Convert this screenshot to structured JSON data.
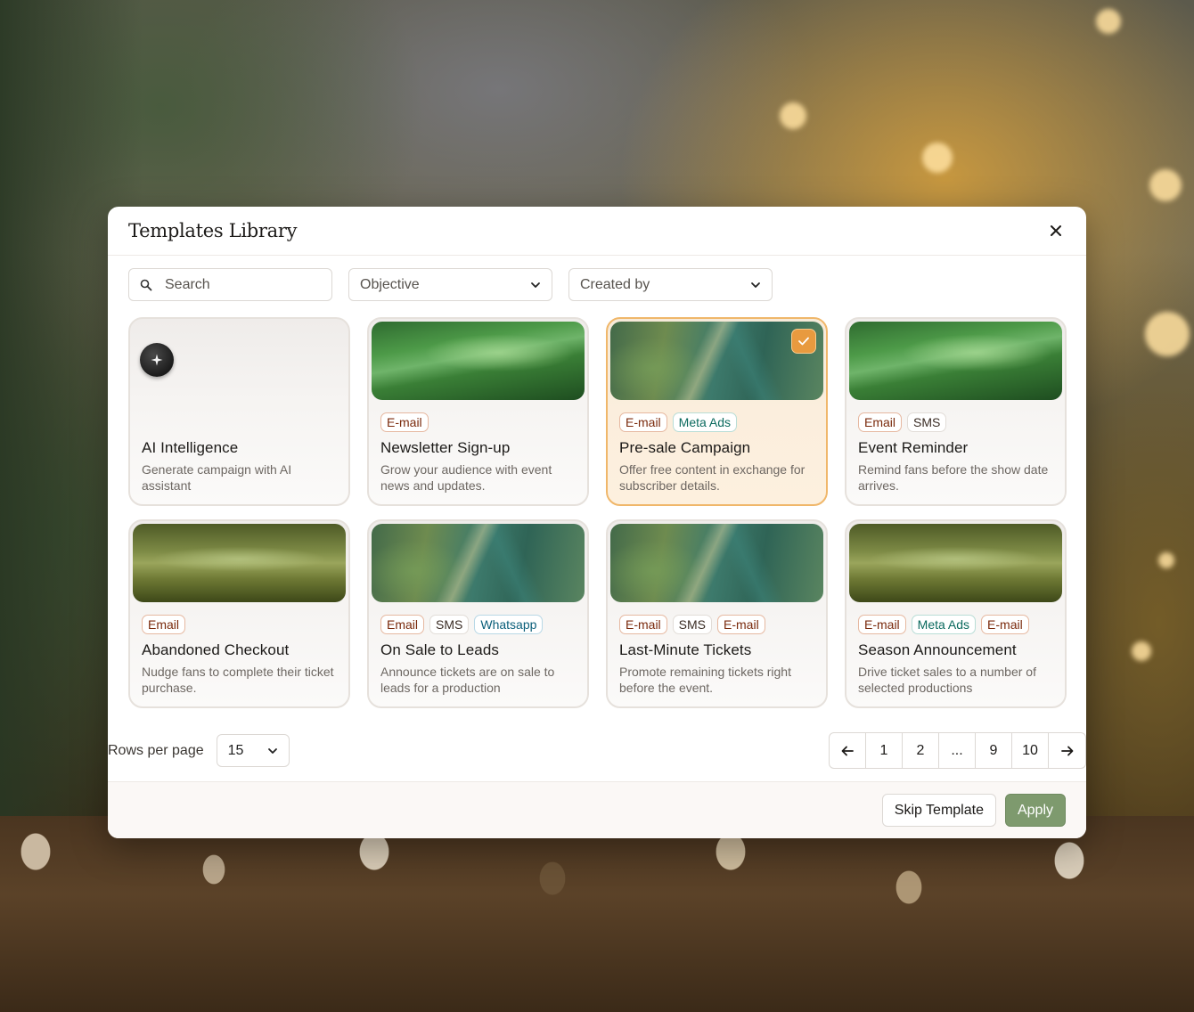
{
  "modal": {
    "title": "Templates Library"
  },
  "filters": {
    "search_placeholder": "Search",
    "objective_label": "Objective",
    "created_by_label": "Created by"
  },
  "cards": [
    {
      "title": "AI Intelligence",
      "description": "Generate campaign with AI assistant",
      "tags": []
    },
    {
      "title": "Newsletter Sign-up",
      "description": "Grow your audience with event news and updates.",
      "tags": [
        "E-mail"
      ]
    },
    {
      "title": "Pre-sale Campaign",
      "description": "Offer free content in exchange for subscriber details.",
      "tags": [
        "E-mail",
        "Meta Ads"
      ],
      "selected": true
    },
    {
      "title": "Event Reminder",
      "description": "Remind fans before the show date arrives.",
      "tags": [
        "Email",
        "SMS"
      ]
    },
    {
      "title": "Abandoned Checkout",
      "description": "Nudge fans to complete their ticket purchase.",
      "tags": [
        "Email"
      ]
    },
    {
      "title": "On Sale to Leads",
      "description": "Announce tickets are on sale to leads for a production",
      "tags": [
        "Email",
        "SMS",
        "Whatsapp"
      ]
    },
    {
      "title": "Last-Minute Tickets",
      "description": "Promote remaining tickets right before the event.",
      "tags": [
        "E-mail",
        "SMS",
        "E-mail"
      ]
    },
    {
      "title": "Season Announcement",
      "description": "Drive ticket sales to a number of selected productions",
      "tags": [
        "E-mail",
        "Meta Ads",
        "E-mail"
      ]
    }
  ],
  "pagination": {
    "rows_per_page_label": "Rows per page",
    "rows_per_page_value": "15",
    "pages": [
      "1",
      "2",
      "...",
      "9",
      "10"
    ]
  },
  "footer": {
    "skip_label": "Skip Template",
    "apply_label": "Apply"
  },
  "colors": {
    "accent_selected": "#e89a3f",
    "apply_button": "#7e9a6e"
  }
}
